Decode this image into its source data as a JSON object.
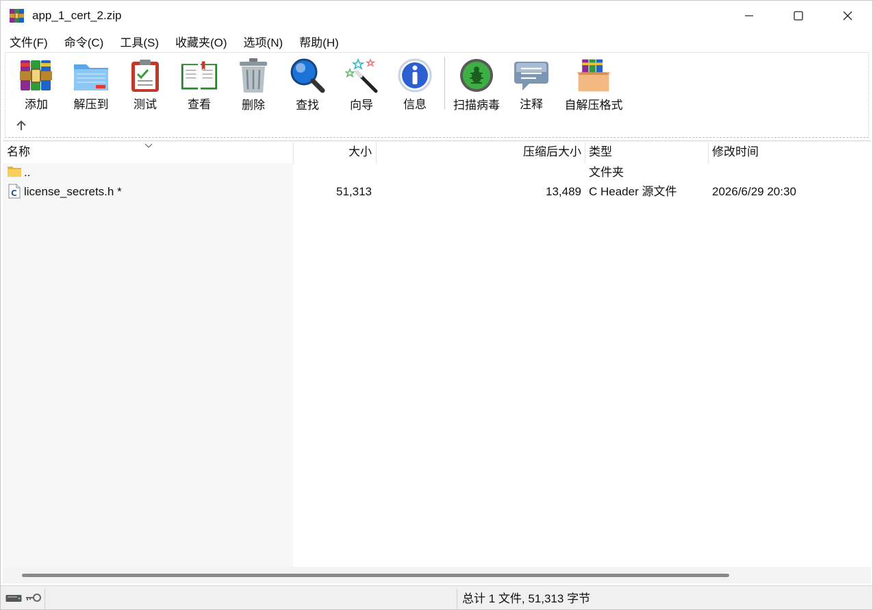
{
  "window": {
    "title": "app_1_cert_2.zip",
    "app_icon": "winrar-books-icon"
  },
  "menu": {
    "items": [
      {
        "label": "文件(F)"
      },
      {
        "label": "命令(C)"
      },
      {
        "label": "工具(S)"
      },
      {
        "label": "收藏夹(O)"
      },
      {
        "label": "选项(N)"
      },
      {
        "label": "帮助(H)"
      }
    ]
  },
  "toolbar": {
    "buttons": [
      {
        "label": "添加",
        "icon": "add-archive-icon"
      },
      {
        "label": "解压到",
        "icon": "extract-folder-icon"
      },
      {
        "label": "测试",
        "icon": "test-clipboard-icon"
      },
      {
        "label": "查看",
        "icon": "view-book-icon"
      },
      {
        "label": "删除",
        "icon": "trash-icon"
      },
      {
        "label": "查找",
        "icon": "magnifier-icon"
      },
      {
        "label": "向导",
        "icon": "wizard-wand-icon"
      },
      {
        "label": "信息",
        "icon": "info-icon"
      },
      {
        "label": "扫描病毒",
        "icon": "virus-scan-icon"
      },
      {
        "label": "注释",
        "icon": "comment-icon"
      },
      {
        "label": "自解压格式",
        "icon": "sfx-box-icon"
      }
    ]
  },
  "columns": {
    "name": "名称",
    "size": "大小",
    "packed": "压缩后大小",
    "type": "类型",
    "modified": "修改时间"
  },
  "files": [
    {
      "name": "..",
      "size": "",
      "packed": "",
      "type": "文件夹",
      "modified": "",
      "icon": "folder-icon"
    },
    {
      "name": "license_secrets.h *",
      "size": "51,313",
      "packed": "13,489",
      "type": "C Header 源文件",
      "modified": "2026/6/29 20:30",
      "icon": "c-header-file-icon"
    }
  ],
  "status": {
    "summary": "总计 1 文件, 51,313 字节"
  },
  "colors": {
    "accent_blue": "#1e73d8",
    "virus_green": "#3cb043"
  }
}
